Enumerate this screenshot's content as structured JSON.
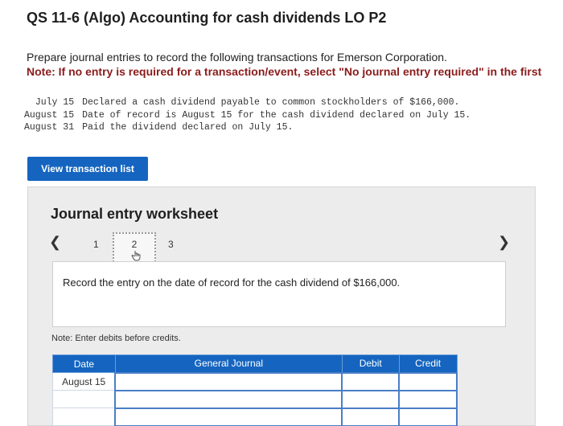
{
  "page": {
    "title": "QS 11-6 (Algo) Accounting for cash dividends LO P2"
  },
  "instructions": {
    "prompt": "Prepare journal entries to record the following transactions for Emerson Corporation.",
    "note": "Note: If no entry is required for a transaction/event, select \"No journal entry required\" in the first"
  },
  "transactions": [
    {
      "date": "July 15",
      "description": "Declared a cash dividend payable to common stockholders of $166,000."
    },
    {
      "date": "August 15",
      "description": "Date of record is August 15 for the cash dividend declared on July 15."
    },
    {
      "date": "August 31",
      "description": "Paid the dividend declared on July 15."
    }
  ],
  "view_button": {
    "label": "View transaction list"
  },
  "worksheet": {
    "title": "Journal entry worksheet",
    "pages": [
      "1",
      "2",
      "3"
    ],
    "current_page": "2",
    "entry_instruction": "Record the entry on the date of record for the cash dividend of $166,000.",
    "note": "Note: Enter debits before credits.",
    "columns": {
      "date": "Date",
      "general_journal": "General Journal",
      "debit": "Debit",
      "credit": "Credit"
    },
    "rows": [
      {
        "date": "August 15",
        "account": "",
        "debit": "",
        "credit": ""
      },
      {
        "date": "",
        "account": "",
        "debit": "",
        "credit": ""
      },
      {
        "date": "",
        "account": "",
        "debit": "",
        "credit": ""
      }
    ]
  },
  "colors": {
    "accent": "#1565c0",
    "note": "#8b1c1c",
    "panel": "#ececec"
  }
}
